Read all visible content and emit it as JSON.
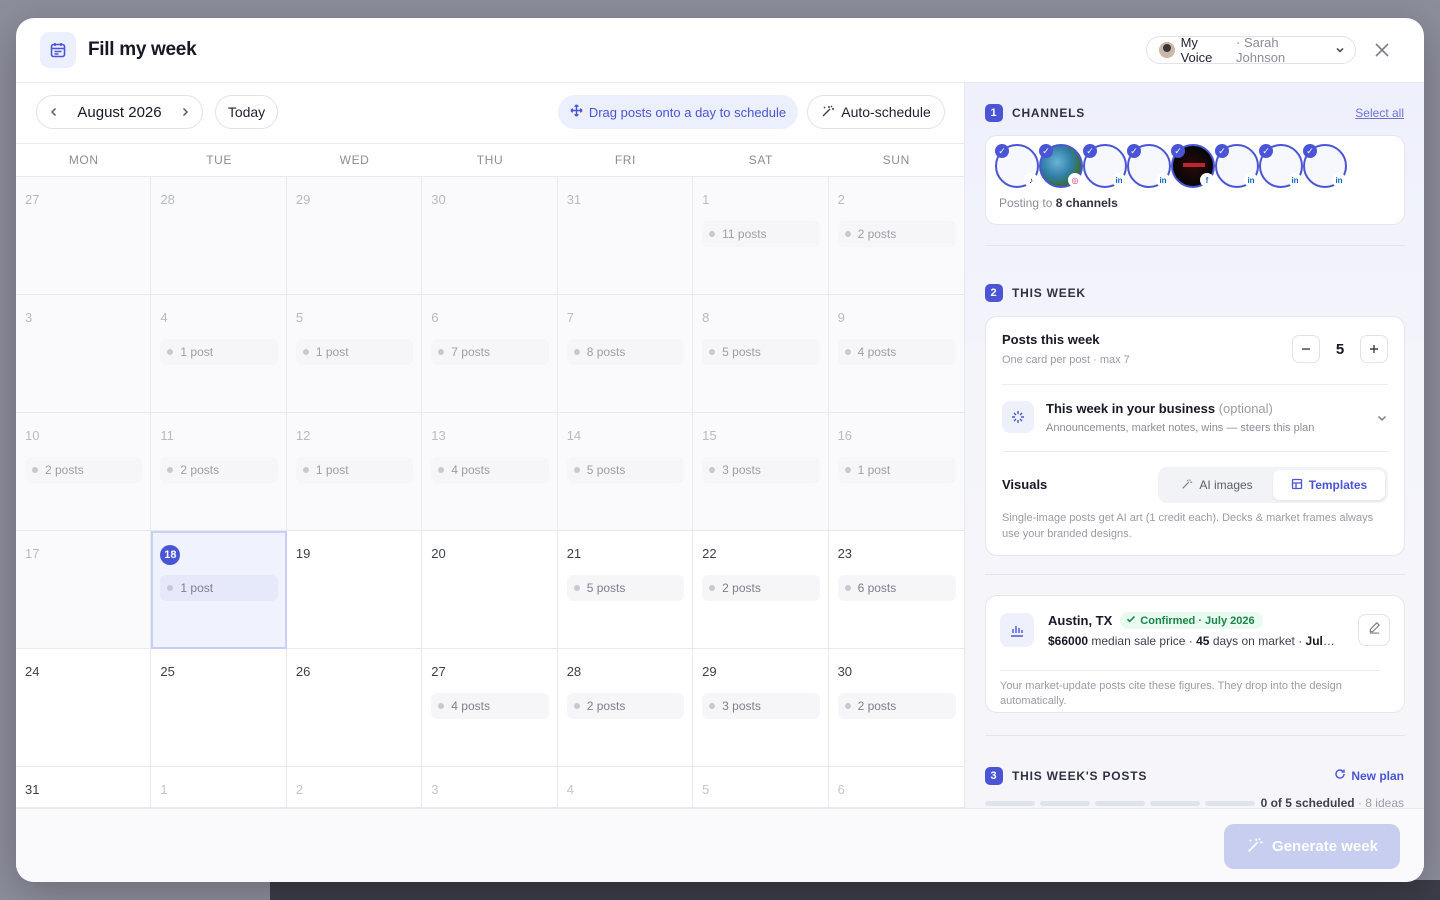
{
  "header": {
    "title": "Fill my week",
    "voice_label": "My Voice",
    "voice_user": "· Sarah Johnson"
  },
  "calendar": {
    "month": "August 2026",
    "today_label": "Today",
    "drag_hint": "Drag posts onto a day to schedule",
    "auto_label": "Auto-schedule",
    "weekdays": [
      "MON",
      "TUE",
      "WED",
      "THU",
      "FRI",
      "SAT",
      "SUN"
    ],
    "days": [
      {
        "n": "27",
        "muted": true,
        "count": ""
      },
      {
        "n": "28",
        "muted": true,
        "count": ""
      },
      {
        "n": "29",
        "muted": true,
        "count": ""
      },
      {
        "n": "30",
        "muted": true,
        "count": ""
      },
      {
        "n": "31",
        "muted": true,
        "count": ""
      },
      {
        "n": "1",
        "muted": true,
        "count": "11 posts"
      },
      {
        "n": "2",
        "muted": true,
        "count": "2 posts"
      },
      {
        "n": "3",
        "muted": true,
        "count": ""
      },
      {
        "n": "4",
        "muted": true,
        "count": "1 post"
      },
      {
        "n": "5",
        "muted": true,
        "count": "1 post"
      },
      {
        "n": "6",
        "muted": true,
        "count": "7 posts"
      },
      {
        "n": "7",
        "muted": true,
        "count": "8 posts"
      },
      {
        "n": "8",
        "muted": true,
        "count": "5 posts"
      },
      {
        "n": "9",
        "muted": true,
        "count": "4 posts"
      },
      {
        "n": "10",
        "muted": true,
        "count": "2 posts"
      },
      {
        "n": "11",
        "muted": true,
        "count": "2 posts"
      },
      {
        "n": "12",
        "muted": true,
        "count": "1 post"
      },
      {
        "n": "13",
        "muted": true,
        "count": "4 posts"
      },
      {
        "n": "14",
        "muted": true,
        "count": "5 posts"
      },
      {
        "n": "15",
        "muted": true,
        "count": "3 posts"
      },
      {
        "n": "16",
        "muted": true,
        "count": "1 post"
      },
      {
        "n": "17",
        "muted": true,
        "count": ""
      },
      {
        "n": "18",
        "today": true,
        "count": "1 post"
      },
      {
        "n": "19",
        "count": ""
      },
      {
        "n": "20",
        "count": ""
      },
      {
        "n": "21",
        "count": "5 posts"
      },
      {
        "n": "22",
        "count": "2 posts"
      },
      {
        "n": "23",
        "count": "6 posts"
      },
      {
        "n": "24",
        "count": ""
      },
      {
        "n": "25",
        "count": ""
      },
      {
        "n": "26",
        "count": ""
      },
      {
        "n": "27",
        "count": "4 posts"
      },
      {
        "n": "28",
        "count": "2 posts"
      },
      {
        "n": "29",
        "count": "3 posts"
      },
      {
        "n": "30",
        "count": "2 posts"
      },
      {
        "n": "31",
        "count": ""
      },
      {
        "n": "1",
        "dim": true,
        "count": ""
      },
      {
        "n": "2",
        "dim": true,
        "count": ""
      },
      {
        "n": "3",
        "dim": true,
        "count": ""
      },
      {
        "n": "4",
        "dim": true,
        "count": ""
      },
      {
        "n": "5",
        "dim": true,
        "count": ""
      },
      {
        "n": "6",
        "dim": true,
        "count": ""
      }
    ]
  },
  "channels": {
    "step": "1",
    "title": "CHANNELS",
    "select_all": "Select all",
    "posting_prefix": "Posting to",
    "posting_count": "8 channels",
    "avatars": [
      {
        "network": "tiktok",
        "style": "plain",
        "badge": "♪"
      },
      {
        "network": "instagram",
        "style": "globe",
        "badge": "◎"
      },
      {
        "network": "linkedin",
        "style": "plain",
        "badge": "in"
      },
      {
        "network": "linkedin",
        "style": "plain",
        "badge": "in"
      },
      {
        "network": "facebook",
        "style": "dark",
        "badge": "f"
      },
      {
        "network": "linkedin",
        "style": "plain",
        "badge": "in"
      },
      {
        "network": "linkedin",
        "style": "plain",
        "badge": "in"
      },
      {
        "network": "linkedin",
        "style": "plain",
        "badge": "in"
      }
    ]
  },
  "this_week": {
    "step": "2",
    "title": "THIS WEEK",
    "posts_title": "Posts this week",
    "posts_sub": "One card per post · max 7",
    "posts_value": "5",
    "biz_title": "This week in your business",
    "biz_optional": "(optional)",
    "biz_sub": "Announcements, market notes, wins — steers this plan",
    "visuals_label": "Visuals",
    "ai_images": "AI images",
    "templates": "Templates",
    "visuals_note": "Single-image posts get AI art (1 credit each). Decks & market frames always use your branded designs."
  },
  "market": {
    "city": "Austin, TX",
    "badge": "Confirmed · July 2026",
    "price": "$66000",
    "price_label": "median sale price ·",
    "days": "45",
    "days_label": "days on market ·",
    "month": "July...",
    "note": "Your market-update posts cite these figures. They drop into the design automatically."
  },
  "posts": {
    "step": "3",
    "title": "THIS WEEK'S POSTS",
    "new_plan": "New plan",
    "scheduled": "0 of 5 scheduled",
    "ideas": "· 8 ideas"
  },
  "footer": {
    "generate": "Generate week"
  },
  "colors": {
    "accent": "#4a55d6",
    "success": "#17864a",
    "disabled_button": "#c7cef0"
  }
}
